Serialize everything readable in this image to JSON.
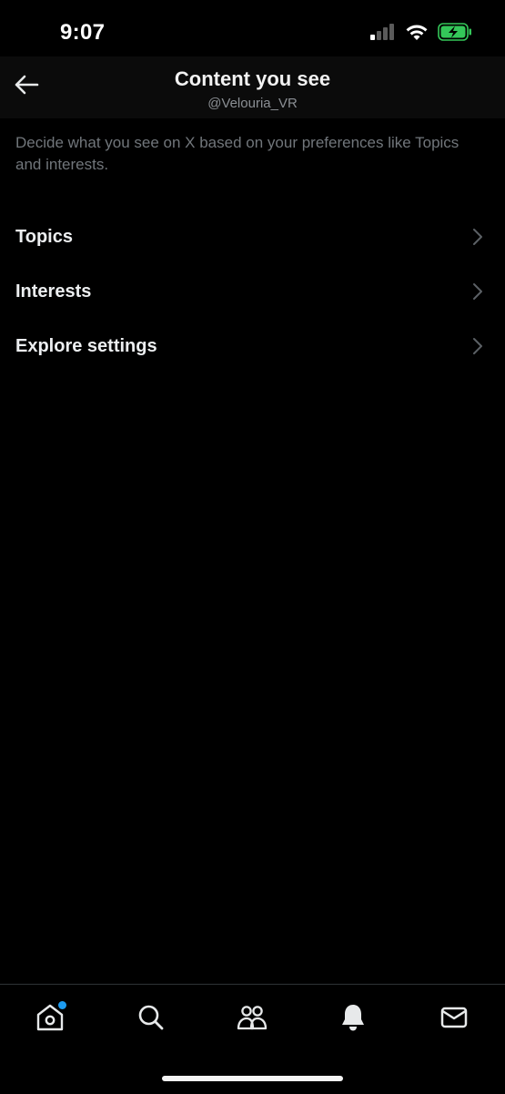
{
  "status_bar": {
    "time": "9:07",
    "icons": [
      "cellular-signal-icon",
      "wifi-icon",
      "battery-charging-icon"
    ],
    "battery_color": "#34c759"
  },
  "header": {
    "back_icon": "back-arrow-icon",
    "title": "Content you see",
    "subtitle": "@Velouria_VR"
  },
  "description": "Decide what you see on X based on your preferences like Topics and interests.",
  "menu": {
    "items": [
      {
        "label": "Topics",
        "icon": "chevron-right-icon"
      },
      {
        "label": "Interests",
        "icon": "chevron-right-icon"
      },
      {
        "label": "Explore settings",
        "icon": "chevron-right-icon"
      }
    ]
  },
  "tab_bar": {
    "tabs": [
      {
        "name": "home",
        "icon": "home-icon",
        "has_unread_dot": true
      },
      {
        "name": "search",
        "icon": "search-icon"
      },
      {
        "name": "communities",
        "icon": "communities-icon"
      },
      {
        "name": "notifications",
        "icon": "bell-icon"
      },
      {
        "name": "messages",
        "icon": "mail-icon"
      }
    ],
    "unread_dot_color": "#1d9bf0"
  }
}
